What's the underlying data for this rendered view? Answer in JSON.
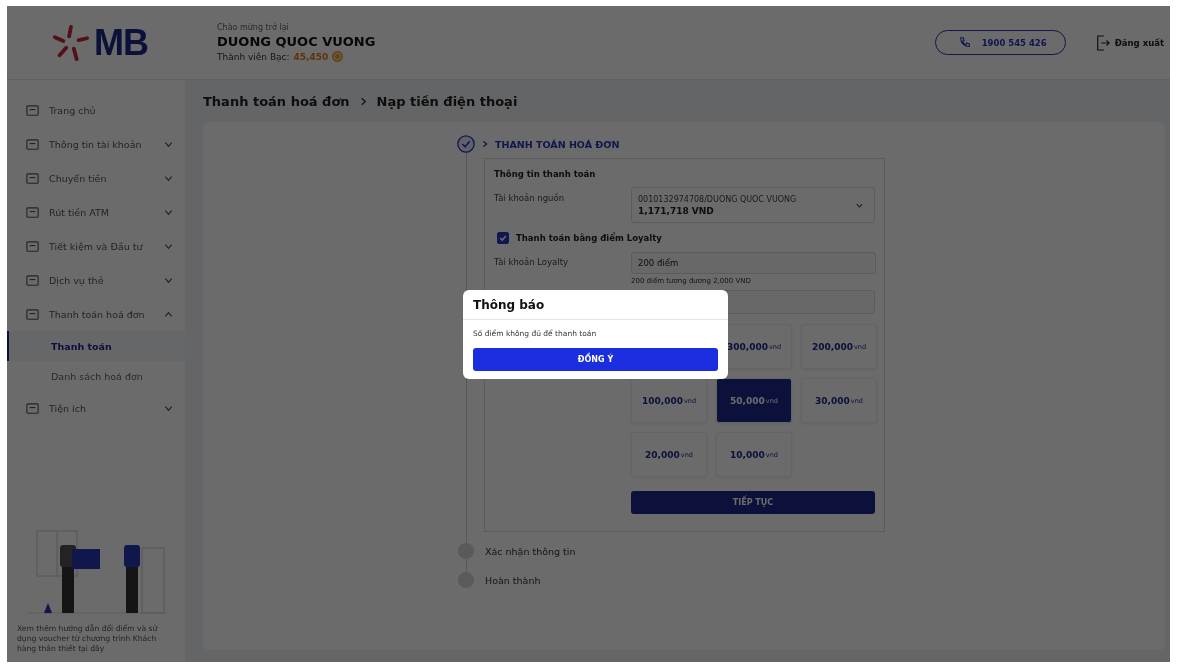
{
  "header": {
    "logo_text": "MB",
    "greeting": "Chào mừng trở lại",
    "user_name": "DUONG QUOC VUONG",
    "member_label": "Thành viên Bạc:",
    "points": "45,450",
    "hotline": "1900 545 426",
    "logout": "Đăng xuất"
  },
  "sidebar": {
    "items": [
      {
        "label": "Trang chủ",
        "kind": "link"
      },
      {
        "label": "Thông tin tài khoản",
        "kind": "group",
        "expanded": false
      },
      {
        "label": "Chuyển tiền",
        "kind": "group",
        "expanded": false
      },
      {
        "label": "Rút tiền ATM",
        "kind": "group",
        "expanded": false
      },
      {
        "label": "Tiết kiệm và Đầu tư",
        "kind": "group",
        "expanded": false
      },
      {
        "label": "Dịch vụ thẻ",
        "kind": "group",
        "expanded": false
      },
      {
        "label": "Thanh toán hoá đơn",
        "kind": "group",
        "expanded": true,
        "children": [
          {
            "label": "Thanh toán",
            "selected": true
          },
          {
            "label": "Danh sách hoá đơn",
            "selected": false
          }
        ]
      },
      {
        "label": "Tiện ích",
        "kind": "group",
        "expanded": false
      }
    ],
    "promo": "Xem thêm hướng dẫn đổi điểm và sử dụng voucher từ chương trình Khách hàng thân thiết tại đây"
  },
  "breadcrumb": [
    "Thanh toán hoá đơn",
    "Nạp tiền điện thoại"
  ],
  "steps": [
    {
      "label": "THANH TOÁN HOÁ ĐƠN",
      "active": true
    },
    {
      "label": "Xác nhận thông tin",
      "active": false
    },
    {
      "label": "Hoàn thành",
      "active": false
    }
  ],
  "form": {
    "title": "Thông tin thanh toán",
    "source_label": "Tài khoản nguồn",
    "source_account": "0010132974708/DUONG QUOC VUONG",
    "source_balance": "1,171,718 VND",
    "loyalty_checkbox": {
      "label": "Thanh toán bằng điểm Loyalty",
      "checked": true
    },
    "loyalty_label": "Tài khoản Loyalty",
    "loyalty_value": "200 điểm",
    "loyalty_hint": "200 điểm tương đương 2,000 VND",
    "amounts": [
      {
        "value": "300,000",
        "unit": "vnd",
        "selected": false
      },
      {
        "value": "200,000",
        "unit": "vnd",
        "selected": false
      },
      {
        "value": "100,000",
        "unit": "vnd",
        "selected": false
      },
      {
        "value": "50,000",
        "unit": "vnd",
        "selected": true
      },
      {
        "value": "30,000",
        "unit": "vnd",
        "selected": false
      },
      {
        "value": "20,000",
        "unit": "vnd",
        "selected": false
      },
      {
        "value": "10,000",
        "unit": "vnd",
        "selected": false
      }
    ],
    "continue_button": "TIẾP TỤC"
  },
  "dialog": {
    "title": "Thông báo",
    "message": "Số điểm không đủ để thanh toán",
    "button": "ĐỒNG Ý"
  }
}
